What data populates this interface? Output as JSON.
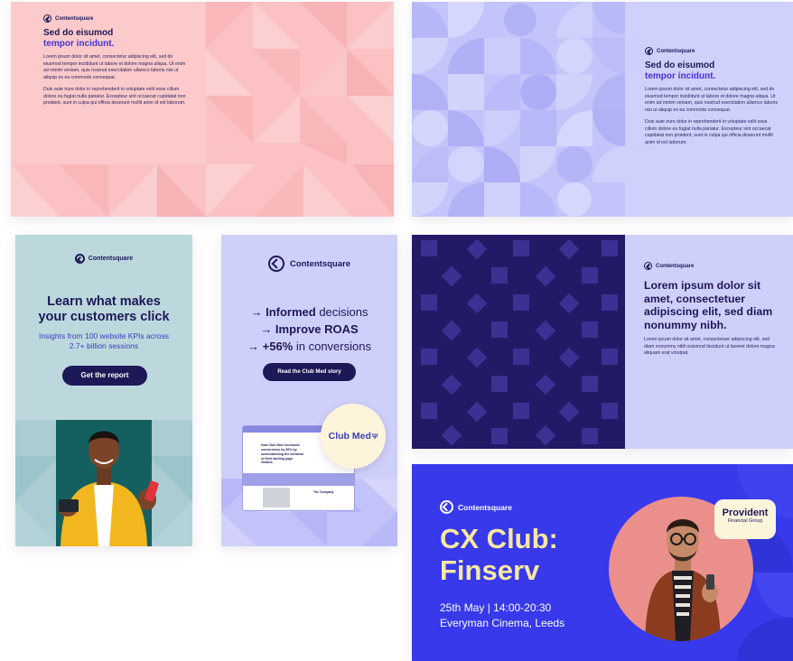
{
  "cards": {
    "c1": {
      "logo": "Contentsquare",
      "heading1": "Sed do eisumod",
      "heading2": "tempor incidunt.",
      "para1": "Lorem ipsum dolor sit amet, consectetur adipiscing elit, sed do eiusmod tempor incididunt ut labore et dolore magna aliqua. Ut enim ad minim veniam, quis nostrud exercitation ullamco laboris nisi ut aliquip ex ea commodo consequat.",
      "para2": "Duis aute irure dolor in reprehenderit in voluptate velit esse cillum dolore eu fugiat nulla pariatur. Excepteur sint occaecat cupidatat non proident, sunt in culpa qui officia deserunt mollit anim id est laborum."
    },
    "c2": {
      "logo": "Contentsquare",
      "heading1": "Sed do eisumod",
      "heading2": "tempor incidunt.",
      "para1": "Lorem ipsum dolor sit amet, consectetur adipiscing elit, sed do eiusmod tempor incididunt ut labore et dolore magna aliqua. Ut enim ad minim veniam, quis nostrud exercitation ullamco laboris nisi ut aliquip ex ea commodo consequat.",
      "para2": "Duis aute irure dolor in reprehenderit in voluptate velit esse cillum dolore eu fugiat nulla pariatur. Excepteur sint occaecat cupidatat non proident, sunt in culpa qui officia deserunt mollit anim id est laborum."
    },
    "c3": {
      "logo": "Contentsquare",
      "heading_line1": "Learn what makes",
      "heading_line2": "your customers click",
      "sub_line1": "Insights from 100 website KPIs across",
      "sub_line2": "2.7+ billion sessions",
      "button": "Get the report"
    },
    "c4": {
      "logo": "Contentsquare",
      "line1_bold": "→ Informed",
      "line1_rest": " decisions",
      "line2": "→ Improve ROAS",
      "line3_bold": "→ +56%",
      "line3_rest": " in conversions",
      "button": "Read the Club Med story",
      "badge": "Club Med",
      "shot_text": "How Club Med increased conversions by 56% by understanding the behavior of their landing page visitors",
      "shot_label": "The Company"
    },
    "c5": {
      "logo": "Contentsquare",
      "heading": "Lorem ipsum dolor sit amet, consectetuer adipiscing elit, sed diam nonummy nibh.",
      "para": "Lorem ipsum dolor sit amet, consectetuer adipiscing elit, sed diam nonummy nibh euismod tincidunt ut laoreet dolore magna aliquam erat volutpat."
    },
    "c6": {
      "logo": "Contentsquare",
      "title_line1": "CX Club:",
      "title_line2": "Finserv",
      "date": "25th May | 14:00-20:30",
      "venue": "Everyman Cinema, Leeds",
      "partner": "Provident",
      "partner_sub": "Financial Group"
    }
  },
  "colors": {
    "navy": "#1d1856",
    "accent_blue": "#4334d6",
    "pink_bg": "#fccacb",
    "lavender_bg": "#cfd0fb",
    "teal_bg": "#bcd8dd",
    "royal_blue": "#3739ea",
    "cream": "#f8e8a2"
  },
  "icons": [
    "contentsquare-logo-icon",
    "person-with-phone-photo",
    "club-med-trident-icon",
    "browser-window-icon"
  ]
}
